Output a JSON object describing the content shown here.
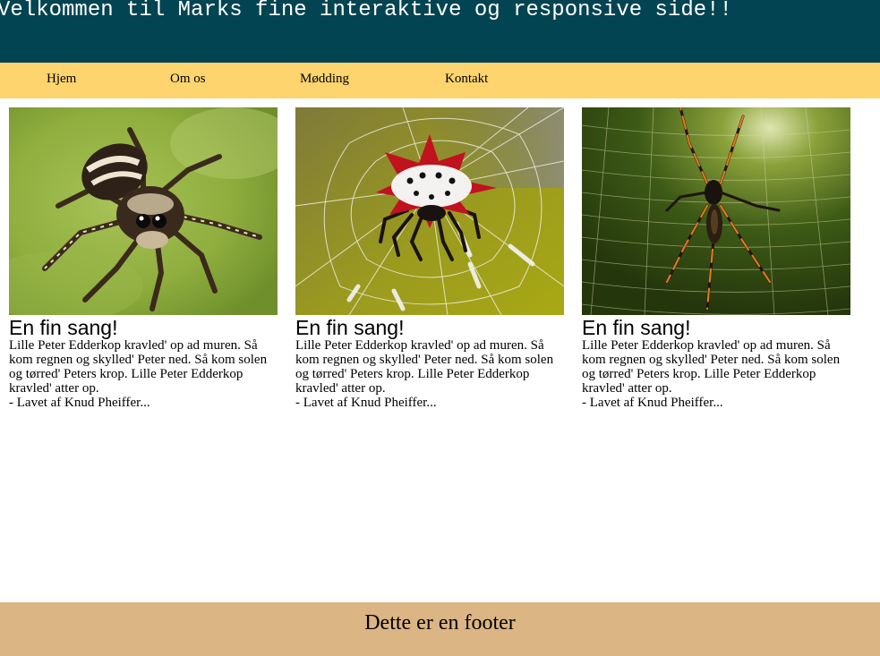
{
  "header": {
    "title": "Velkommen til Marks fine interaktive og responsive side!!"
  },
  "nav": {
    "items": [
      {
        "label": "Hjem"
      },
      {
        "label": "Om os"
      },
      {
        "label": "Mødding"
      },
      {
        "label": "Kontakt"
      }
    ]
  },
  "cards": [
    {
      "title": "En fin sang!",
      "text": "Lille Peter Edderkop kravled' op ad muren. Så kom regnen og skylled' Peter ned. Så kom solen og tørred' Peters krop. Lille Peter Edderkop kravled' atter op.",
      "credit": "- Lavet af Knud Pheiffer..."
    },
    {
      "title": "En fin sang!",
      "text": "Lille Peter Edderkop kravled' op ad muren. Så kom regnen og skylled' Peter ned. Så kom solen og tørred' Peters krop. Lille Peter Edderkop kravled' atter op.",
      "credit": "- Lavet af Knud Pheiffer..."
    },
    {
      "title": "En fin sang!",
      "text": "Lille Peter Edderkop kravled' op ad muren. Så kom regnen og skylled' Peter ned. Så kom solen og tørred' Peters krop. Lille Peter Edderkop kravled' atter op.",
      "credit": "- Lavet af Knud Pheiffer..."
    }
  ],
  "footer": {
    "text": "Dette er en footer"
  },
  "colors": {
    "header_bg": "#024451",
    "nav_bg": "#fdd46e",
    "footer_bg": "#dcb584"
  }
}
